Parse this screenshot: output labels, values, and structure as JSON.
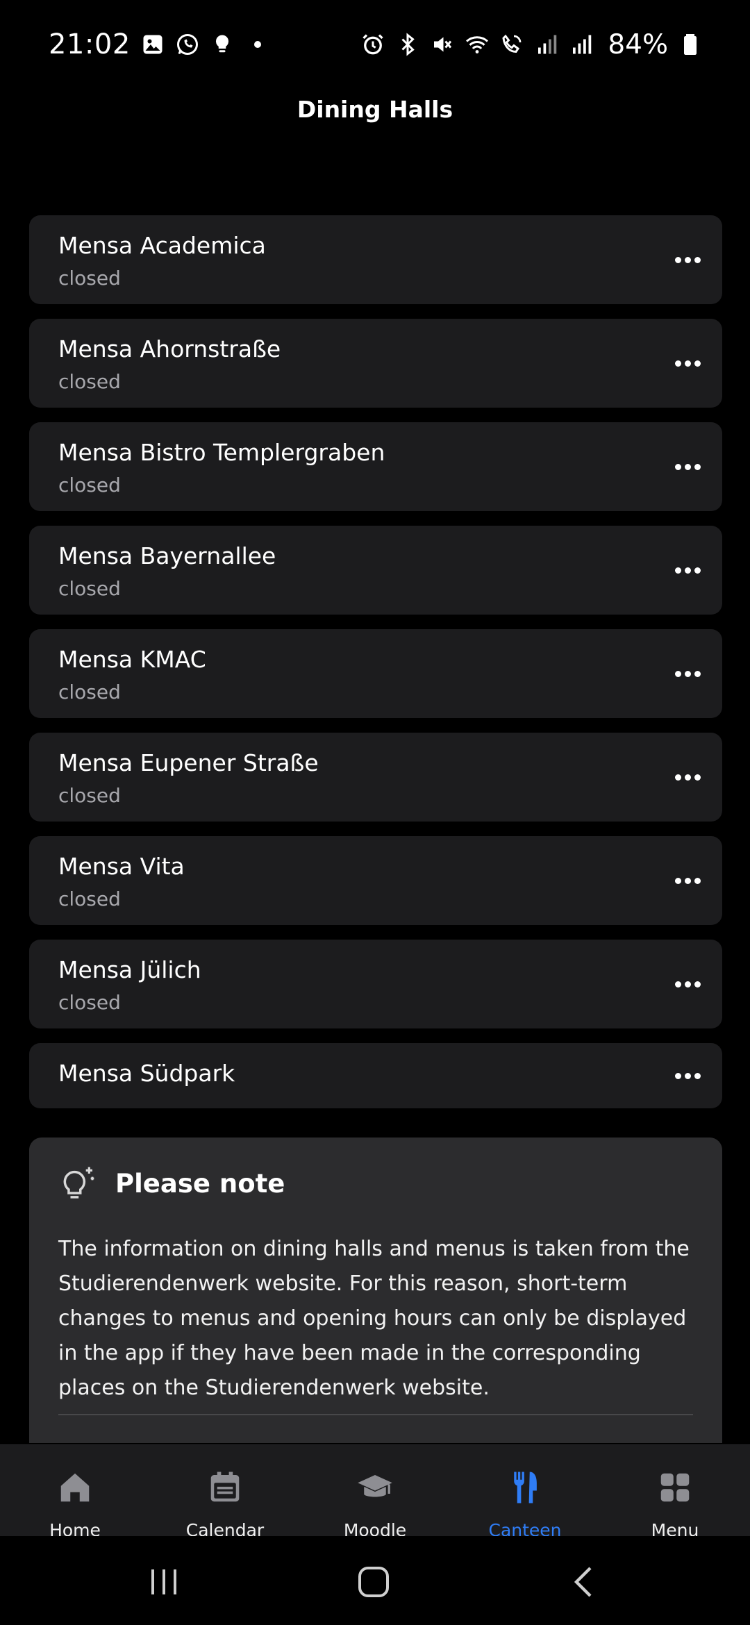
{
  "status_bar": {
    "time": "21:02",
    "battery": "84%",
    "left_icons": [
      "gallery-icon",
      "whatsapp-icon",
      "bulb-icon",
      "dot-icon"
    ],
    "right_icons": [
      "alarm-icon",
      "bluetooth-icon",
      "mute-icon",
      "wifi-icon",
      "wifi-call-icon",
      "signal-roaming-icon",
      "signal-icon",
      "battery-icon"
    ]
  },
  "header": {
    "title": "Dining Halls"
  },
  "halls": [
    {
      "name": "Mensa Academica",
      "status": "closed"
    },
    {
      "name": "Mensa Ahornstraße",
      "status": "closed"
    },
    {
      "name": "Mensa Bistro Templergraben",
      "status": "closed"
    },
    {
      "name": "Mensa Bayernallee",
      "status": "closed"
    },
    {
      "name": "Mensa KMAC",
      "status": "closed"
    },
    {
      "name": "Mensa Eupener Straße",
      "status": "closed"
    },
    {
      "name": "Mensa Vita",
      "status": "closed"
    },
    {
      "name": "Mensa Jülich",
      "status": "closed"
    },
    {
      "name": "Mensa Südpark",
      "status": ""
    }
  ],
  "note": {
    "icon": "lightbulb-sparkle-icon",
    "title": "Please note",
    "text": "The information on dining halls and menus is taken from the Studierendenwerk website. For this reason, short-term changes to menus and opening hours can only be displayed in the app if they have been made in the corresponding places on the Studierendenwerk website."
  },
  "tabs": [
    {
      "label": "Home",
      "icon": "home-icon",
      "active": false
    },
    {
      "label": "Calendar",
      "icon": "calendar-icon",
      "active": false
    },
    {
      "label": "Moodle",
      "icon": "graduation-cap-icon",
      "active": false
    },
    {
      "label": "Canteen",
      "icon": "fork-knife-icon",
      "active": true
    },
    {
      "label": "Menu",
      "icon": "grid-icon",
      "active": false
    }
  ],
  "colors": {
    "background": "#000000",
    "card": "#1c1c1e",
    "note_card": "#2c2c2e",
    "accent": "#2f7df6",
    "secondary_text": "#a8a8ad"
  }
}
